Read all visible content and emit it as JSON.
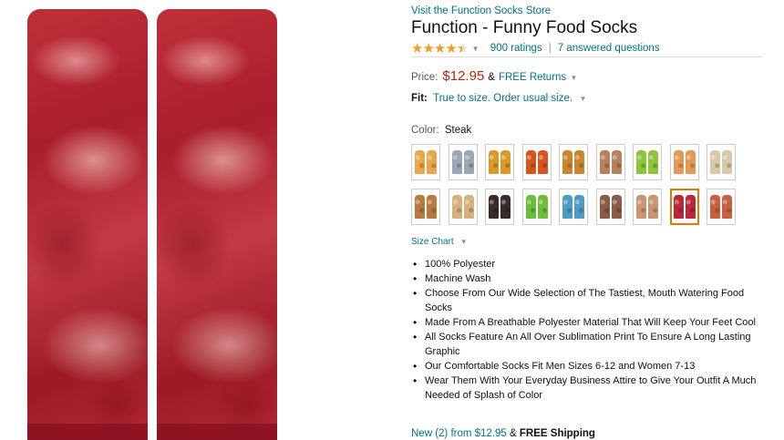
{
  "product": {
    "store_link": "Visit the Function Socks Store",
    "title": "Function - Funny Food Socks",
    "rating_value": 4.5,
    "ratings_count": "900 ratings",
    "separator": "|",
    "answered_questions": "7 answered questions",
    "price_label": "Price:",
    "price": "$12.95",
    "price_amp": "&",
    "free_returns": "FREE Returns",
    "fit_label": "Fit:",
    "fit_value": "True to size. Order usual size.",
    "color_label": "Color:",
    "color_value": "Steak",
    "size_chart": "Size Chart",
    "bullets": [
      "100% Polyester",
      "Machine Wash",
      "Choose From Our Wide Selection of The Tastiest, Mouth Watering Food Socks",
      "Made From A Breathable Polyester Material That Will Keep Your Feet Cool",
      "All Socks Feature An All Over Sublimation Print To Ensure A Long Lasting Graphic",
      "Our Comfortable Socks Fit Men Sizes 6-12 and Women 7-13",
      "Wear Them With Your Everyday Business Attire to Give Your Outfit A Much Needed of Splash of Color"
    ],
    "new_offer": "New (2) from $12.95",
    "new_offer_amp": "&",
    "new_offer_shipping": "FREE Shipping"
  },
  "swatches": [
    {
      "color": "#e9a64a",
      "pattern": "pizza"
    },
    {
      "color": "#9aa7b6",
      "pattern": "grey"
    },
    {
      "color": "#d99a2b",
      "pattern": "nuggets"
    },
    {
      "color": "#d8541e",
      "pattern": "orange"
    },
    {
      "color": "#c8872f",
      "pattern": "fries"
    },
    {
      "color": "#b9805e",
      "pattern": "brown"
    },
    {
      "color": "#8cc43a",
      "pattern": "green"
    },
    {
      "color": "#e39a55",
      "pattern": "peach"
    },
    {
      "color": "#d9c7a5",
      "pattern": "pair"
    },
    {
      "color": "#b87a3e",
      "pattern": "cookie"
    },
    {
      "color": "#d6b17a",
      "pattern": "beige"
    },
    {
      "color": "#3a2a2a",
      "pattern": "dark-dots"
    },
    {
      "color": "#6bbd3a",
      "pattern": "lime"
    },
    {
      "color": "#4d9cc4",
      "pattern": "blue"
    },
    {
      "color": "#8a5a44",
      "pattern": "photo"
    },
    {
      "color": "#c99574",
      "pattern": "tan"
    },
    {
      "color": "#b82838",
      "pattern": "steak",
      "selected": true
    },
    {
      "color": "#c8603e",
      "pattern": "bacon"
    }
  ],
  "colors": {
    "link": "#007185",
    "price": "#b12704",
    "star": "#f0a020",
    "selected_border": "#e77600"
  }
}
